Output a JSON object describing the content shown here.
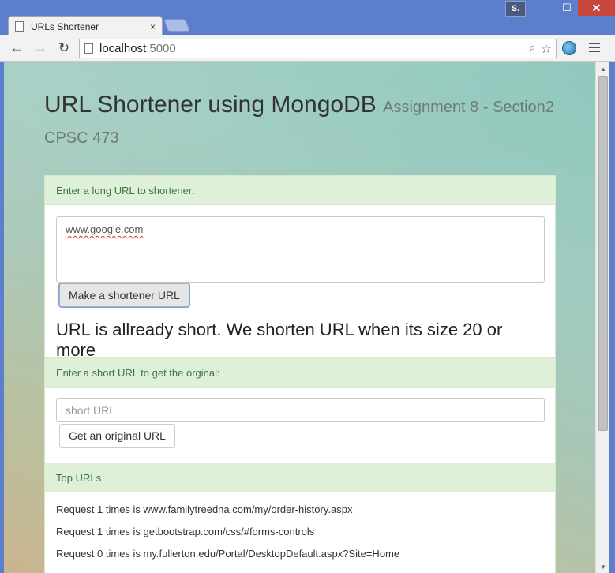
{
  "window": {
    "user_badge": "S.",
    "minimize": "—",
    "maximize": "☐",
    "close": "✕"
  },
  "tab": {
    "title": "URLs Shortener",
    "close": "×"
  },
  "toolbar": {
    "back": "←",
    "forward": "→",
    "reload": "↻",
    "url_host": "localhost",
    "url_port": ":5000",
    "zoom_icon": "⌕",
    "star_icon": "☆"
  },
  "page": {
    "title": "URL Shortener using MongoDB",
    "subtitle": "Assignment 8 - Section2 CPSC 473"
  },
  "shorten_panel": {
    "heading": "Enter a long URL to shortener:",
    "textarea_value": "www.google.com",
    "button_label": "Make a shortener URL",
    "message": "URL is allready short. We shorten URL when its size 20 or more"
  },
  "original_panel": {
    "heading": "Enter a short URL to get the orginal:",
    "input_placeholder": "short URL",
    "button_label": "Get an original URL"
  },
  "top_panel": {
    "heading": "Top URLs",
    "items": [
      "Request 1 times is www.familytreedna.com/my/order-history.aspx",
      "Request 1 times is getbootstrap.com/css/#forms-controls",
      "Request 0 times is my.fullerton.edu/Portal/DesktopDefault.aspx?Site=Home"
    ]
  },
  "colors": {
    "panel_heading_bg": "#dff0d8",
    "panel_heading_text": "#3c763d",
    "title_bar": "#5b7fcc",
    "close_button": "#c7473d"
  }
}
